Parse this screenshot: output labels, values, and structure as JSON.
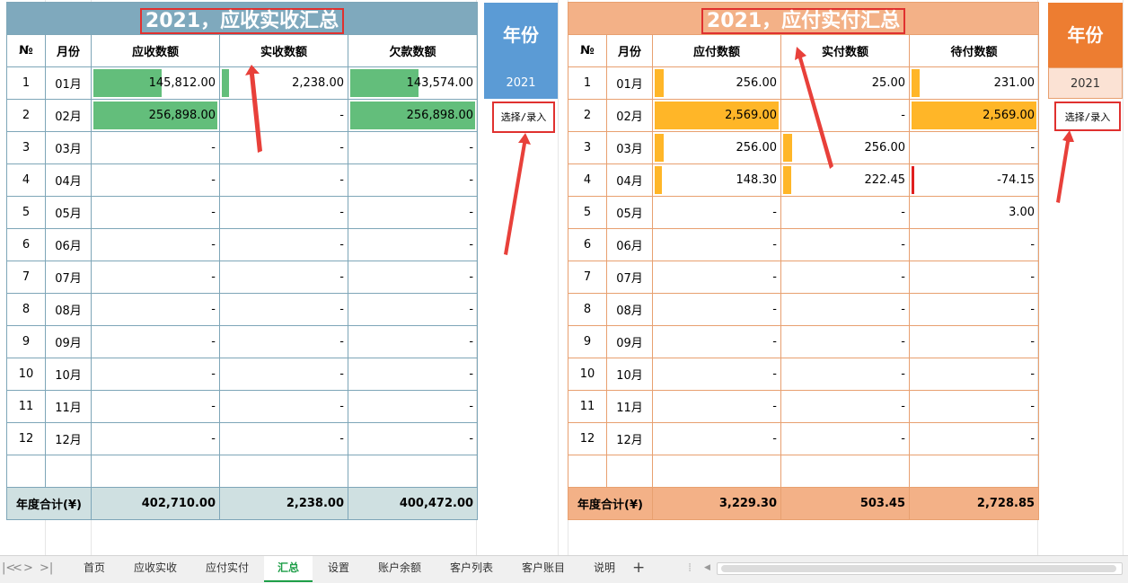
{
  "left": {
    "title": "2021，应收实收汇总",
    "headers": [
      "№",
      "月份",
      "应收数额",
      "实收数额",
      "欠款数额"
    ],
    "rows": [
      {
        "no": "1",
        "month": "01月",
        "a": "145,812.00",
        "b": "2,238.00",
        "c": "143,574.00",
        "a_frac": 0.566,
        "b_frac": 0.009,
        "c_frac": 0.559
      },
      {
        "no": "2",
        "month": "02月",
        "a": "256,898.00",
        "b": "-",
        "c": "256,898.00",
        "a_frac": 1.0,
        "b_frac": 0,
        "c_frac": 1.0
      },
      {
        "no": "3",
        "month": "03月",
        "a": "-",
        "b": "-",
        "c": "-"
      },
      {
        "no": "4",
        "month": "04月",
        "a": "-",
        "b": "-",
        "c": "-"
      },
      {
        "no": "5",
        "month": "05月",
        "a": "-",
        "b": "-",
        "c": "-"
      },
      {
        "no": "6",
        "month": "06月",
        "a": "-",
        "b": "-",
        "c": "-"
      },
      {
        "no": "7",
        "month": "07月",
        "a": "-",
        "b": "-",
        "c": "-"
      },
      {
        "no": "8",
        "month": "08月",
        "a": "-",
        "b": "-",
        "c": "-"
      },
      {
        "no": "9",
        "month": "09月",
        "a": "-",
        "b": "-",
        "c": "-"
      },
      {
        "no": "10",
        "month": "10月",
        "a": "-",
        "b": "-",
        "c": "-"
      },
      {
        "no": "11",
        "month": "11月",
        "a": "-",
        "b": "-",
        "c": "-"
      },
      {
        "no": "12",
        "month": "12月",
        "a": "-",
        "b": "-",
        "c": "-"
      }
    ],
    "total_label": "年度合计(¥)",
    "totals": [
      "402,710.00",
      "2,238.00",
      "400,472.00"
    ],
    "bar_color": "#63be7b"
  },
  "right": {
    "title": "2021，应付实付汇总",
    "headers": [
      "№",
      "月份",
      "应付数额",
      "实付数额",
      "待付数额"
    ],
    "rows": [
      {
        "no": "1",
        "month": "01月",
        "a": "256.00",
        "b": "25.00",
        "c": "231.00",
        "a_frac": 0.1,
        "b_frac": 0.0,
        "c_frac": 0.09
      },
      {
        "no": "2",
        "month": "02月",
        "a": "2,569.00",
        "b": "-",
        "c": "2,569.00",
        "a_frac": 1.0,
        "b_frac": 0,
        "c_frac": 1.0
      },
      {
        "no": "3",
        "month": "03月",
        "a": "256.00",
        "b": "256.00",
        "c": "-",
        "a_frac": 0.1,
        "b_frac": 0.1,
        "c_frac": 0
      },
      {
        "no": "4",
        "month": "04月",
        "a": "148.30",
        "b": "222.45",
        "c": "-74.15",
        "a_frac": 0.06,
        "b_frac": 0.09,
        "c_frac": 0,
        "c_neg": true
      },
      {
        "no": "5",
        "month": "05月",
        "a": "-",
        "b": "-",
        "c": "3.00"
      },
      {
        "no": "6",
        "month": "06月",
        "a": "-",
        "b": "-",
        "c": "-"
      },
      {
        "no": "7",
        "month": "07月",
        "a": "-",
        "b": "-",
        "c": "-"
      },
      {
        "no": "8",
        "month": "08月",
        "a": "-",
        "b": "-",
        "c": "-"
      },
      {
        "no": "9",
        "month": "09月",
        "a": "-",
        "b": "-",
        "c": "-"
      },
      {
        "no": "10",
        "month": "10月",
        "a": "-",
        "b": "-",
        "c": "-"
      },
      {
        "no": "11",
        "month": "11月",
        "a": "-",
        "b": "-",
        "c": "-"
      },
      {
        "no": "12",
        "month": "12月",
        "a": "-",
        "b": "-",
        "c": "-"
      }
    ],
    "total_label": "年度合计(¥)",
    "totals": [
      "3,229.30",
      "503.45",
      "2,728.85"
    ],
    "bar_color": "#ffb628",
    "neg_color": "#e02020"
  },
  "year_left": {
    "title": "年份",
    "value": "2021",
    "hint": "选择/录入",
    "title_bg": "#5b9bd5"
  },
  "year_right": {
    "title": "年份",
    "value": "2021",
    "hint": "选择/录入",
    "title_bg": "#ed7d31"
  },
  "tabs": {
    "nav": [
      "|<",
      "<",
      ">",
      ">|"
    ],
    "items": [
      "首页",
      "应收实收",
      "应付实付",
      "汇总",
      "设置",
      "账户余额",
      "客户列表",
      "客户账目",
      "说明"
    ],
    "active": "汇总",
    "add": "+"
  }
}
